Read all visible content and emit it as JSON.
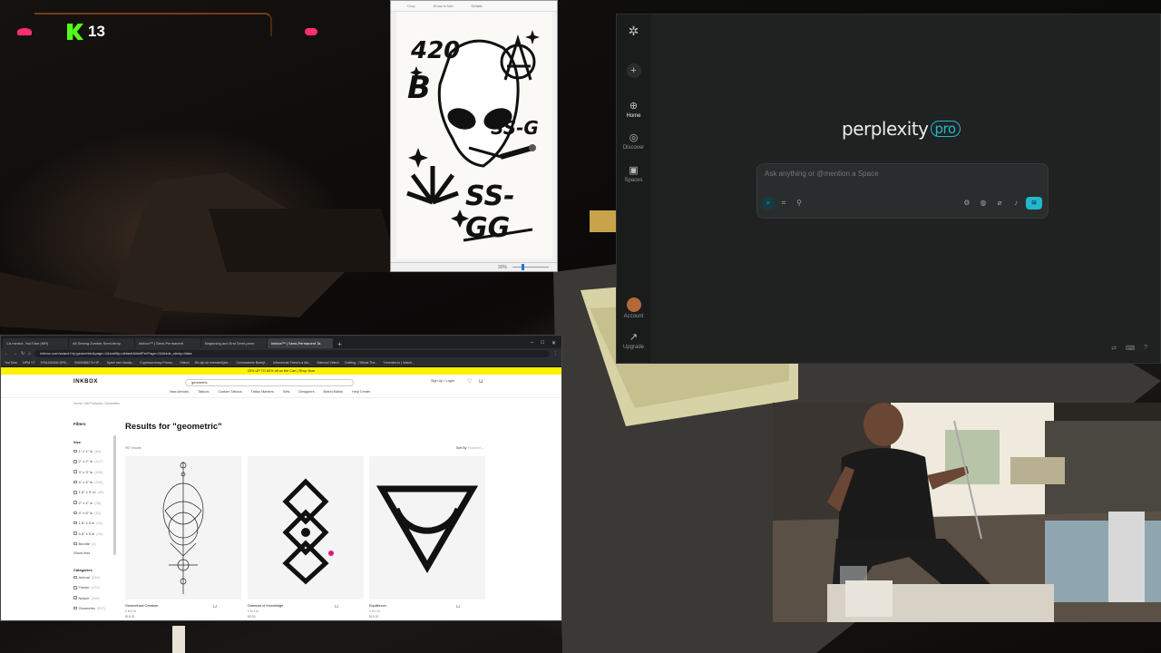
{
  "overlay": {
    "viewer_count": "13"
  },
  "image_viewer": {
    "toolbar": [
      "Crop",
      "Show in fold",
      "Details"
    ],
    "art_words": {
      "top_left": "420",
      "mid_right": "SS-G",
      "bottom": "SS-GG"
    },
    "zoom": "30%"
  },
  "perplexity": {
    "logo_text": "perplexity",
    "logo_badge": "pro",
    "rail": [
      "Home",
      "Discover",
      "Spaces",
      "Account",
      "Upgrade"
    ],
    "ask_placeholder": "Ask anything or @mention a Space"
  },
  "browser": {
    "tabs": [
      "Ca mentor. YouTube (MR)",
      "All Seeing Zombie Semi-temp",
      "Inkbox™ | Semi-Permanent",
      "Beginning and End Semi-perm",
      "Inkbox™ | Semi-Permanent Ta"
    ],
    "url": "inkbox.com/search?q=geometric&page=1&sortBy=default&limitPerPage=24&hide_sticky=false",
    "bookmarks": [
      "YouTube",
      "NPM YT",
      "9781430400 DRC...",
      "B0000B8274 HP...",
      "Speel met Vanda...",
      "Cryptocurrency Prices...",
      "Hitech",
      "Dit zijn de meesterlijkst...",
      "Coinmarkete Bedrijf...",
      "Infomercial There's a Mo...",
      "Sitemod Video!",
      "Crafting - Official The...",
      "Yummies.to | Watch..."
    ],
    "promo": "25% UP TO 60% off on the Cart | Shop Now",
    "brand": "INKBOX",
    "search_value": "geometric",
    "nav": [
      "New Arrivals",
      "Tattoos",
      "Custom Tattoos",
      "Tattoo Markers",
      "Sets",
      "Designers",
      "Brand Marks",
      "Help Center"
    ],
    "account": "Sign Up / Login",
    "breadcrumb": "Home  /  All Products  /  Geometric",
    "results_title": "Results for \"geometric\"",
    "results_count": "997 results",
    "sort_label": "Sort By",
    "sort_value": "Featured",
    "filters_title": "Filters",
    "size_title": "Size",
    "sizes": [
      {
        "label": "1\" x 1\" in",
        "count": "(84)"
      },
      {
        "label": "2\" x 2\" in",
        "count": "(127)"
      },
      {
        "label": "3\" x 3\" in",
        "count": "(196)"
      },
      {
        "label": "4\" x 4\" in",
        "count": "(229)"
      },
      {
        "label": "1.5\" x 3\" in",
        "count": "(30)"
      },
      {
        "label": "2\" x 4\" in",
        "count": "(28)"
      },
      {
        "label": "4\" x 8\" in",
        "count": "(51)"
      },
      {
        "label": "1.5\" x 3 in",
        "count": "(21)"
      },
      {
        "label": "4.5\" x 5 in",
        "count": "(33)"
      },
      {
        "label": "Bundle",
        "count": "(4)"
      }
    ],
    "show_less": "Show less",
    "category_title": "Categories",
    "categories": [
      {
        "label": "Animal",
        "count": "(234)"
      },
      {
        "label": "Flower",
        "count": "(172)"
      },
      {
        "label": "Nature",
        "count": "(248)"
      },
      {
        "label": "Geometric",
        "count": "(997)"
      }
    ],
    "products": [
      {
        "name": "Geometrical Creature",
        "sub": "2 in 2 in",
        "price": "$19.00"
      },
      {
        "name": "Diamond of Knowledge",
        "sub": "1 in 1 in",
        "price": "$9.00"
      },
      {
        "name": "Equilibrium",
        "sub": "1 in 1 in",
        "price": "$19.00"
      }
    ]
  }
}
